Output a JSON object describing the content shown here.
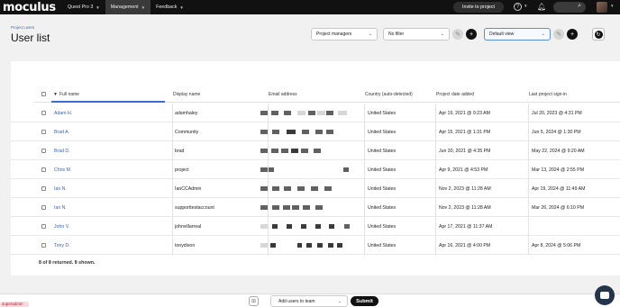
{
  "nav": {
    "logo": "moculus",
    "items": [
      {
        "label": "Quest Pro 3",
        "active": false
      },
      {
        "label": "Management",
        "active": true
      },
      {
        "label": "Feedback",
        "active": false
      }
    ],
    "invite_label": "Invite to project",
    "help_icon": "question-circle-icon",
    "bell_icon": "bell-icon",
    "search_icon": "search-icon"
  },
  "header": {
    "breadcrumb": "Project users",
    "title": "User list",
    "role_filter": "Project managers",
    "filter": "No filter",
    "view": "Default view"
  },
  "table": {
    "columns": [
      "Full name",
      "Display name",
      "Email address",
      "Country (auto-detected)",
      "Project date added",
      "Last project sign-in"
    ],
    "sort_indicator": "▼",
    "rows": [
      {
        "name": "Adam H.",
        "display": "adamhaley",
        "country": "United States",
        "added": "Apr 19, 2021 @ 9:23 AM",
        "last": "Jul 20, 2023 @ 4:31 PM"
      },
      {
        "name": "Brad A.",
        "display": "Community",
        "country": "United States",
        "added": "Apr 15, 2021 @ 1:31 PM",
        "last": "Jun 5, 2024 @ 1:30 PM"
      },
      {
        "name": "Brad D.",
        "display": "brad",
        "country": "United States",
        "added": "Jun 30, 2021 @ 4:35 PM",
        "last": "May 22, 2024 @ 9:20 AM"
      },
      {
        "name": "Chris M.",
        "display": "project",
        "country": "United States",
        "added": "Apr 9, 2021 @ 4:53 PM",
        "last": "Mar 13, 2024 @ 2:55 PM"
      },
      {
        "name": "Ian N.",
        "display": "IanCCAdmin",
        "country": "United States",
        "added": "Nov 2, 2023 @ 11:28 AM",
        "last": "Apr 19, 2024 @ 11:49 AM"
      },
      {
        "name": "Ian N.",
        "display": "supporttestaccount",
        "country": "United States",
        "added": "Nov 2, 2023 @ 11:28 AM",
        "last": "Mar 26, 2024 @ 6:10 PM"
      },
      {
        "name": "John V.",
        "display": "johnvillarreal",
        "country": "United States",
        "added": "Apr 17, 2021 @ 11:37 AM",
        "last": ""
      },
      {
        "name": "Tony D.",
        "display": "tonydixon",
        "country": "United States",
        "added": "Apr 16, 2021 @ 4:00 PM",
        "last": "Apr 8, 2024 @ 5:06 PM"
      }
    ],
    "summary": "8 of 8 returned. 8 shown."
  },
  "bottom": {
    "add_select": "Add users to team",
    "submit": "Submit",
    "tag_label": "superadmin"
  },
  "colors": {
    "accent": "#3a6bd8",
    "link": "#3b62b8",
    "nav_bg": "#111111"
  }
}
